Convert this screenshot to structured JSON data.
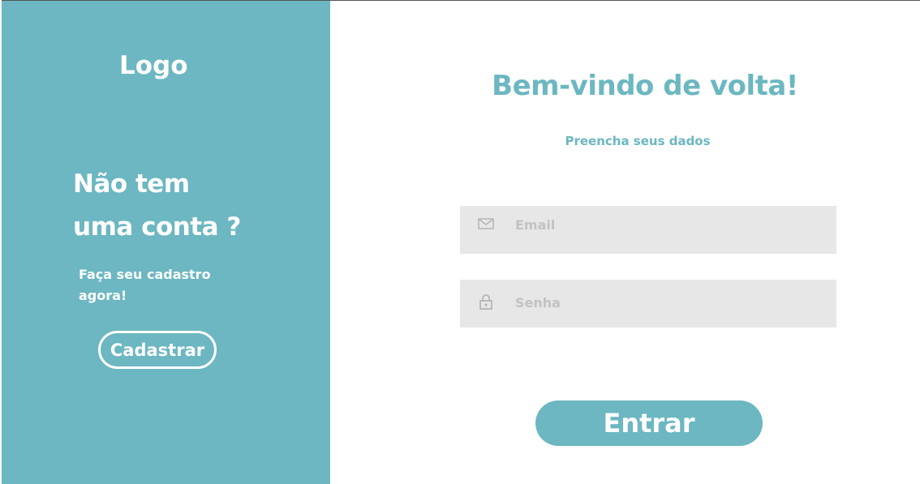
{
  "left_panel": {
    "logo": "Logo",
    "heading_line1": "Não tem",
    "heading_line2": "uma conta ?",
    "subtext_line1": "Faça seu cadastro",
    "subtext_line2": "agora!",
    "signup_button_label": "Cadastrar",
    "background_color": "#6cb7c1"
  },
  "login_form": {
    "title": "Bem-vindo de volta!",
    "subtitle": "Preencha seus dados",
    "email": {
      "icon": "mail-icon",
      "placeholder": "Email",
      "value": ""
    },
    "password": {
      "icon": "lock-icon",
      "placeholder": "Senha",
      "value": ""
    },
    "submit_label": "Entrar",
    "accent_color": "#6cb7c1",
    "field_background": "#e7e7e7"
  }
}
